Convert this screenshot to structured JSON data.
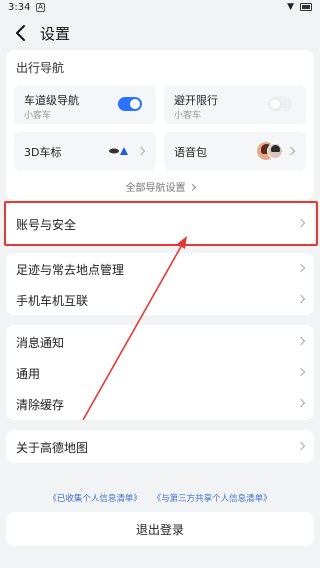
{
  "status_bar": {
    "time": "3:34",
    "notification_glyph": "A"
  },
  "header": {
    "title": "设置"
  },
  "navigation": {
    "section_title": "出行导航",
    "lane_nav": {
      "label": "车道级导航",
      "sub": "小客车",
      "enabled": true
    },
    "restriction": {
      "label": "避开限行",
      "sub": "小客车",
      "enabled": false
    },
    "car_icon": {
      "label": "3D车标"
    },
    "voice_pack": {
      "label": "语音包"
    },
    "all_settings": "全部导航设置"
  },
  "account": {
    "label": "账号与安全"
  },
  "places": {
    "items": [
      {
        "label": "足迹与常去地点管理"
      },
      {
        "label": "手机车机互联"
      }
    ]
  },
  "general": {
    "items": [
      {
        "label": "消息通知"
      },
      {
        "label": "通用"
      },
      {
        "label": "清除缓存"
      }
    ]
  },
  "about": {
    "label": "关于高德地图"
  },
  "links": {
    "collected": "《已收集个人信息清单》",
    "shared": "《与第三方共享个人信息清单》"
  },
  "logout": {
    "label": "退出登录"
  },
  "colors": {
    "accent": "#2b72ff",
    "highlight": "#e53935",
    "link": "#3b6fd8",
    "background": "#f2f3f5"
  }
}
